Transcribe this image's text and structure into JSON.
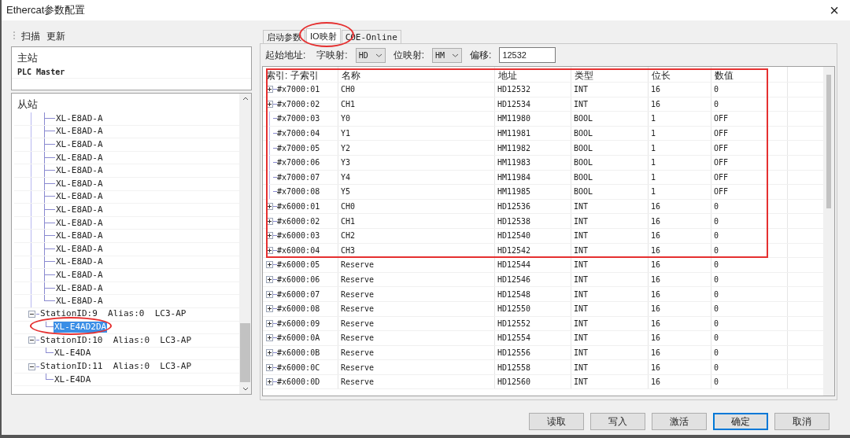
{
  "window": {
    "title": "Ethercat参数配置",
    "close": "×"
  },
  "left_toolbar": [
    "扫描",
    "更新"
  ],
  "master": {
    "header": "主站",
    "items": [
      "PLC Master"
    ]
  },
  "slave": {
    "header": "从站",
    "continued_children": [
      {
        "label": "XL-E8AD-A",
        "selected": false
      },
      {
        "label": "XL-E8AD-A",
        "selected": false
      },
      {
        "label": "XL-E8AD-A",
        "selected": false
      },
      {
        "label": "XL-E8AD-A",
        "selected": false
      },
      {
        "label": "XL-E8AD-A",
        "selected": false
      },
      {
        "label": "XL-E8AD-A",
        "selected": false
      },
      {
        "label": "XL-E8AD-A",
        "selected": false
      },
      {
        "label": "XL-E8AD-A",
        "selected": false
      },
      {
        "label": "XL-E8AD-A",
        "selected": false
      },
      {
        "label": "XL-E8AD-A",
        "selected": false
      },
      {
        "label": "XL-E8AD-A",
        "selected": false
      },
      {
        "label": "XL-E8AD-A",
        "selected": false
      },
      {
        "label": "XL-E8AD-A",
        "selected": false
      },
      {
        "label": "XL-E8AD-A",
        "selected": false
      },
      {
        "label": "XL-E8AD-A",
        "selected": false
      }
    ],
    "stations": [
      {
        "label": "StationID:9  Alias:0  LC3-AP",
        "expanded": true,
        "children": [
          {
            "label": "XL-E4AD2DA",
            "selected": true
          }
        ]
      },
      {
        "label": "StationID:10  Alias:0  LC3-AP",
        "expanded": true,
        "children": [
          {
            "label": "XL-E4DA",
            "selected": false
          }
        ]
      },
      {
        "label": "StationID:11  Alias:0  LC3-AP",
        "expanded": true,
        "children": [
          {
            "label": "XL-E4DA",
            "selected": false
          }
        ]
      }
    ]
  },
  "tabs": [
    {
      "label": "启动参数",
      "selected": false
    },
    {
      "label": "IO映射",
      "selected": true
    },
    {
      "label": "COE-Online",
      "selected": false
    }
  ],
  "mapping": {
    "start_label": "起始地址:",
    "word_label": "字映射:",
    "word_value": "HD",
    "bit_label": "位映射:",
    "bit_value": "HM",
    "offset_label": "偏移:",
    "offset_value": "12532"
  },
  "table": {
    "columns": [
      "索引: 子索引",
      "名称",
      "地址",
      "类型",
      "位长",
      "数值"
    ],
    "rows": [
      {
        "expandable": true,
        "index": "#x7000:01",
        "name": "CH0",
        "address": "HD12532",
        "type": "INT",
        "bits": "16",
        "value": "0"
      },
      {
        "expandable": true,
        "index": "#x7000:02",
        "name": "CH1",
        "address": "HD12534",
        "type": "INT",
        "bits": "16",
        "value": "0"
      },
      {
        "expandable": false,
        "index": "#x7000:03",
        "name": "Y0",
        "address": "HM11980",
        "type": "BOOL",
        "bits": "1",
        "value": "OFF"
      },
      {
        "expandable": false,
        "index": "#x7000:04",
        "name": "Y1",
        "address": "HM11981",
        "type": "BOOL",
        "bits": "1",
        "value": "OFF"
      },
      {
        "expandable": false,
        "index": "#x7000:05",
        "name": "Y2",
        "address": "HM11982",
        "type": "BOOL",
        "bits": "1",
        "value": "OFF"
      },
      {
        "expandable": false,
        "index": "#x7000:06",
        "name": "Y3",
        "address": "HM11983",
        "type": "BOOL",
        "bits": "1",
        "value": "OFF"
      },
      {
        "expandable": false,
        "index": "#x7000:07",
        "name": "Y4",
        "address": "HM11984",
        "type": "BOOL",
        "bits": "1",
        "value": "OFF"
      },
      {
        "expandable": false,
        "index": "#x7000:08",
        "name": "Y5",
        "address": "HM11985",
        "type": "BOOL",
        "bits": "1",
        "value": "OFF"
      },
      {
        "expandable": true,
        "index": "#x6000:01",
        "name": "CH0",
        "address": "HD12536",
        "type": "INT",
        "bits": "16",
        "value": "0"
      },
      {
        "expandable": true,
        "index": "#x6000:02",
        "name": "CH1",
        "address": "HD12538",
        "type": "INT",
        "bits": "16",
        "value": "0"
      },
      {
        "expandable": true,
        "index": "#x6000:03",
        "name": "CH2",
        "address": "HD12540",
        "type": "INT",
        "bits": "16",
        "value": "0"
      },
      {
        "expandable": true,
        "index": "#x6000:04",
        "name": "CH3",
        "address": "HD12542",
        "type": "INT",
        "bits": "16",
        "value": "0"
      },
      {
        "expandable": true,
        "index": "#x6000:05",
        "name": "Reserve",
        "address": "HD12544",
        "type": "INT",
        "bits": "16",
        "value": "0"
      },
      {
        "expandable": true,
        "index": "#x6000:06",
        "name": "Reserve",
        "address": "HD12546",
        "type": "INT",
        "bits": "16",
        "value": "0"
      },
      {
        "expandable": true,
        "index": "#x6000:07",
        "name": "Reserve",
        "address": "HD12548",
        "type": "INT",
        "bits": "16",
        "value": "0"
      },
      {
        "expandable": true,
        "index": "#x6000:08",
        "name": "Reserve",
        "address": "HD12550",
        "type": "INT",
        "bits": "16",
        "value": "0"
      },
      {
        "expandable": true,
        "index": "#x6000:09",
        "name": "Reserve",
        "address": "HD12552",
        "type": "INT",
        "bits": "16",
        "value": "0"
      },
      {
        "expandable": true,
        "index": "#x6000:0A",
        "name": "Reserve",
        "address": "HD12554",
        "type": "INT",
        "bits": "16",
        "value": "0"
      },
      {
        "expandable": true,
        "index": "#x6000:0B",
        "name": "Reserve",
        "address": "HD12556",
        "type": "INT",
        "bits": "16",
        "value": "0"
      },
      {
        "expandable": true,
        "index": "#x6000:0C",
        "name": "Reserve",
        "address": "HD12558",
        "type": "INT",
        "bits": "16",
        "value": "0"
      },
      {
        "expandable": true,
        "index": "#x6000:0D",
        "name": "Reserve",
        "address": "HD12560",
        "type": "INT",
        "bits": "16",
        "value": "0"
      }
    ]
  },
  "buttons": [
    {
      "label": "读取",
      "focused": false
    },
    {
      "label": "写入",
      "focused": false
    },
    {
      "label": "激活",
      "focused": false
    },
    {
      "label": "确定",
      "focused": true
    },
    {
      "label": "取消",
      "focused": false
    }
  ]
}
